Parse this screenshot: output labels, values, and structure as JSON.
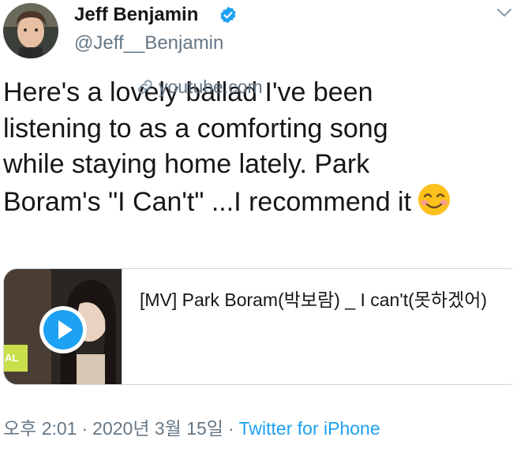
{
  "author": {
    "name": "Jeff Benjamin",
    "handle": "@Jeff__Benjamin",
    "verified": true,
    "avatar_icon": "user-avatar"
  },
  "menu": {
    "icon": "chevron-down-icon"
  },
  "tweet": {
    "lines": [
      "Here's a lovely ballad I've been",
      "listening to as a comforting song",
      "while staying home lately. Park",
      "Boram's \"I Can't\" ...I recommend it"
    ],
    "emoji": "smiling-face-with-smiling-eyes"
  },
  "card": {
    "title": "[MV] Park Boram(박보람) _ I can't(못하겠어)",
    "domain": "youtube.com",
    "thumbnail_tag": "AL",
    "play_icon": "play-icon",
    "link_icon": "link-icon"
  },
  "meta": {
    "time": "오후 2:01",
    "date": "2020년 3월 15일",
    "separator": "·",
    "source": "Twitter for iPhone"
  },
  "colors": {
    "text": "#14171a",
    "secondary": "#657786",
    "link": "#1da1f2",
    "border": "#ccd6dd"
  }
}
